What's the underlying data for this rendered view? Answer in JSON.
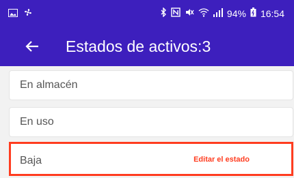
{
  "status_bar": {
    "battery": "94%",
    "time": "16:54",
    "icons": [
      "image-icon",
      "fan-icon",
      "bluetooth-icon",
      "nfc-icon",
      "mute-icon",
      "wifi-icon",
      "signal-icon",
      "battery-icon"
    ]
  },
  "app_bar": {
    "back_icon": "arrow-left-icon",
    "title": "Estados de activos:3"
  },
  "list": {
    "items": [
      {
        "label": "En almacén"
      },
      {
        "label": "En uso"
      },
      {
        "label": "Baja",
        "action": "Editar el estado"
      }
    ]
  },
  "colors": {
    "primary": "#3d1fbd",
    "highlight": "#ff3c1f"
  }
}
